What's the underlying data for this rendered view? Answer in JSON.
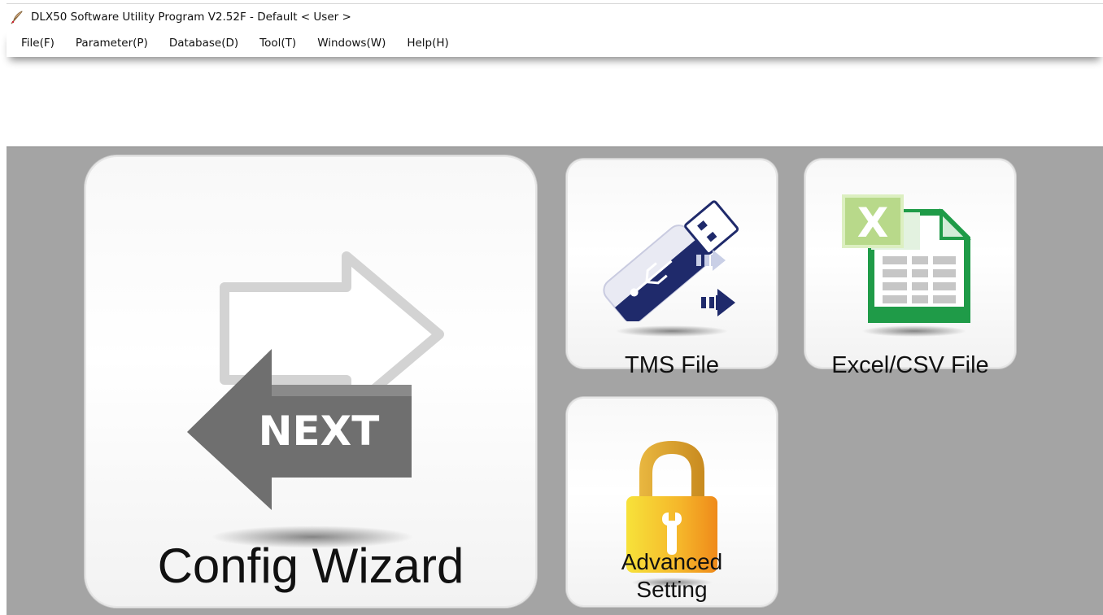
{
  "window": {
    "title": "DLX50 Software Utility Program V2.52F - Default < User >",
    "icon": "feather-pen-icon"
  },
  "menu": {
    "items": [
      {
        "label": "File(F)"
      },
      {
        "label": "Parameter(P)"
      },
      {
        "label": "Database(D)"
      },
      {
        "label": "Tool(T)"
      },
      {
        "label": "Windows(W)"
      },
      {
        "label": "Help(H)"
      }
    ]
  },
  "tiles": {
    "config_wizard": {
      "label": "Config Wizard",
      "icon": "next-arrows-icon",
      "icon_text": "NEXT"
    },
    "tms_file": {
      "label": "TMS File",
      "icon": "usb-drive-icon"
    },
    "excel_csv_file": {
      "label": "Excel/CSV File",
      "icon": "excel-file-icon",
      "icon_text": "X"
    },
    "advanced_setting": {
      "label_line1": "Advanced",
      "label_line2": "Setting",
      "icon": "padlock-wrench-icon"
    }
  },
  "colors": {
    "workspace_bg": "#a4a4a4",
    "usb_navy": "#1f2a6b",
    "excel_green": "#1f9b48",
    "lock_orange": "#f39a1e"
  }
}
